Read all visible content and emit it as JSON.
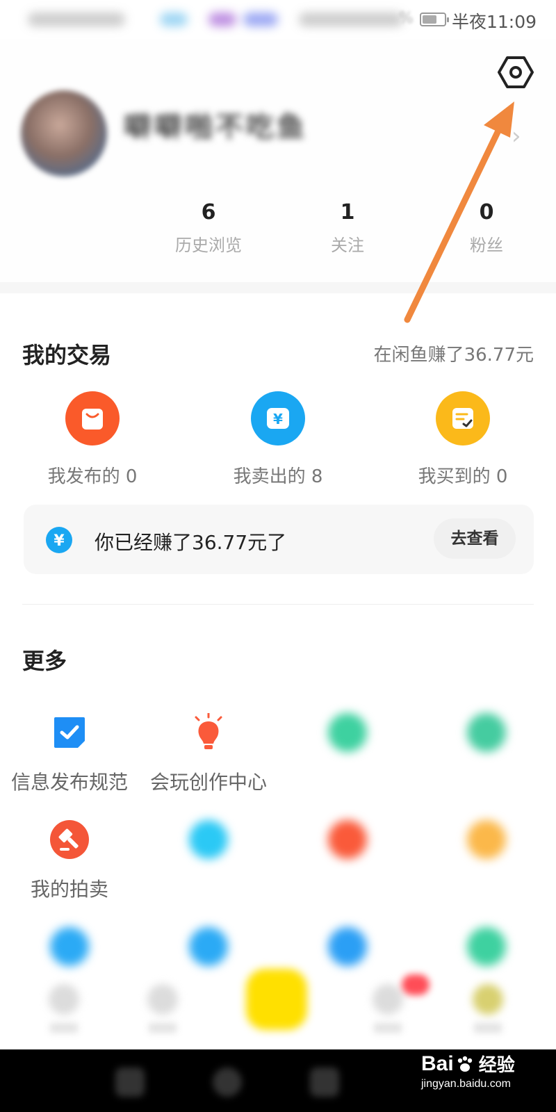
{
  "status_bar": {
    "time": "半夜11:09",
    "percent": "%"
  },
  "profile": {
    "username": "噼噼啪不吃鱼",
    "subtitle": "",
    "stats": [
      {
        "value": "",
        "label": ""
      },
      {
        "value": "6",
        "label": "历史浏览"
      },
      {
        "value": "1",
        "label": "关注"
      },
      {
        "value": "0",
        "label": "粉丝"
      }
    ]
  },
  "my_trades": {
    "title": "我的交易",
    "earned_summary": "在闲鱼赚了36.77元",
    "items": [
      {
        "label": "我发布的 0",
        "icon": "shopping-bag-icon",
        "color": "#fa5a2a"
      },
      {
        "label": "我卖出的 8",
        "icon": "yen-icon",
        "color": "#1aa7f2"
      },
      {
        "label": "我买到的 0",
        "icon": "receipt-check-icon",
        "color": "#fbb91a"
      }
    ],
    "banner": {
      "text": "你已经赚了36.77元了",
      "button": "去查看"
    }
  },
  "more": {
    "title": "更多",
    "items": [
      {
        "label": "信息发布规范",
        "icon": "checkbox-icon",
        "color": "#1e8ef5"
      },
      {
        "label": "会玩创作中心",
        "icon": "lightbulb-icon",
        "color": "#fa5a3a"
      },
      {
        "label": "",
        "icon": "blurred-icon",
        "color": "#3ed1a0"
      },
      {
        "label": "",
        "icon": "blurred-icon",
        "color": "#45cca0"
      },
      {
        "label": "我的拍卖",
        "icon": "auction-hammer-icon",
        "color": "#f45638"
      },
      {
        "label": "",
        "icon": "blurred-icon",
        "color": "#2bc9f5"
      },
      {
        "label": "",
        "icon": "blurred-icon",
        "color": "#fa5a3a"
      },
      {
        "label": "",
        "icon": "blurred-icon",
        "color": "#fbb84a"
      },
      {
        "label": "",
        "icon": "headset-icon",
        "color": "#2baaf5"
      },
      {
        "label": "",
        "icon": "blurred-icon",
        "color": "#2baaf5"
      },
      {
        "label": "",
        "icon": "blurred-icon",
        "color": "#2b9ff5"
      },
      {
        "label": "",
        "icon": "blurred-icon",
        "color": "#3ed1a0"
      }
    ]
  },
  "watermark": {
    "logo_left": "Bai",
    "logo_right": "经验",
    "url": "jingyan.baidu.com"
  }
}
